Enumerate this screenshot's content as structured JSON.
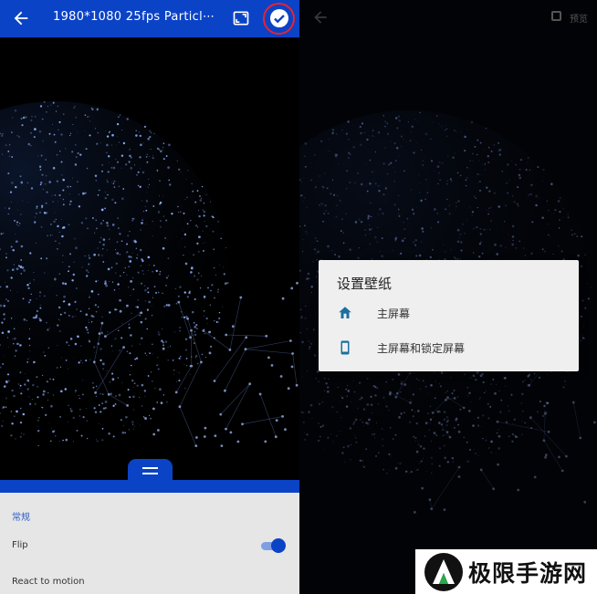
{
  "left_screen": {
    "app_bar": {
      "title": "1980*1080 25fps Particl⋯",
      "color": "#0b43c7"
    },
    "settings": {
      "section_title": "常规",
      "flip_label": "Flip",
      "flip_enabled": true,
      "react_label": "React to motion"
    }
  },
  "right_screen": {
    "preview_label": "预览",
    "preview_checked": false,
    "dialog": {
      "title": "设置壁纸",
      "options": [
        {
          "label": "主屏幕",
          "icon": "home-icon"
        },
        {
          "label": "主屏幕和锁定屏幕",
          "icon": "phone-icon"
        }
      ]
    }
  },
  "watermark": {
    "text": "极限手游网"
  }
}
